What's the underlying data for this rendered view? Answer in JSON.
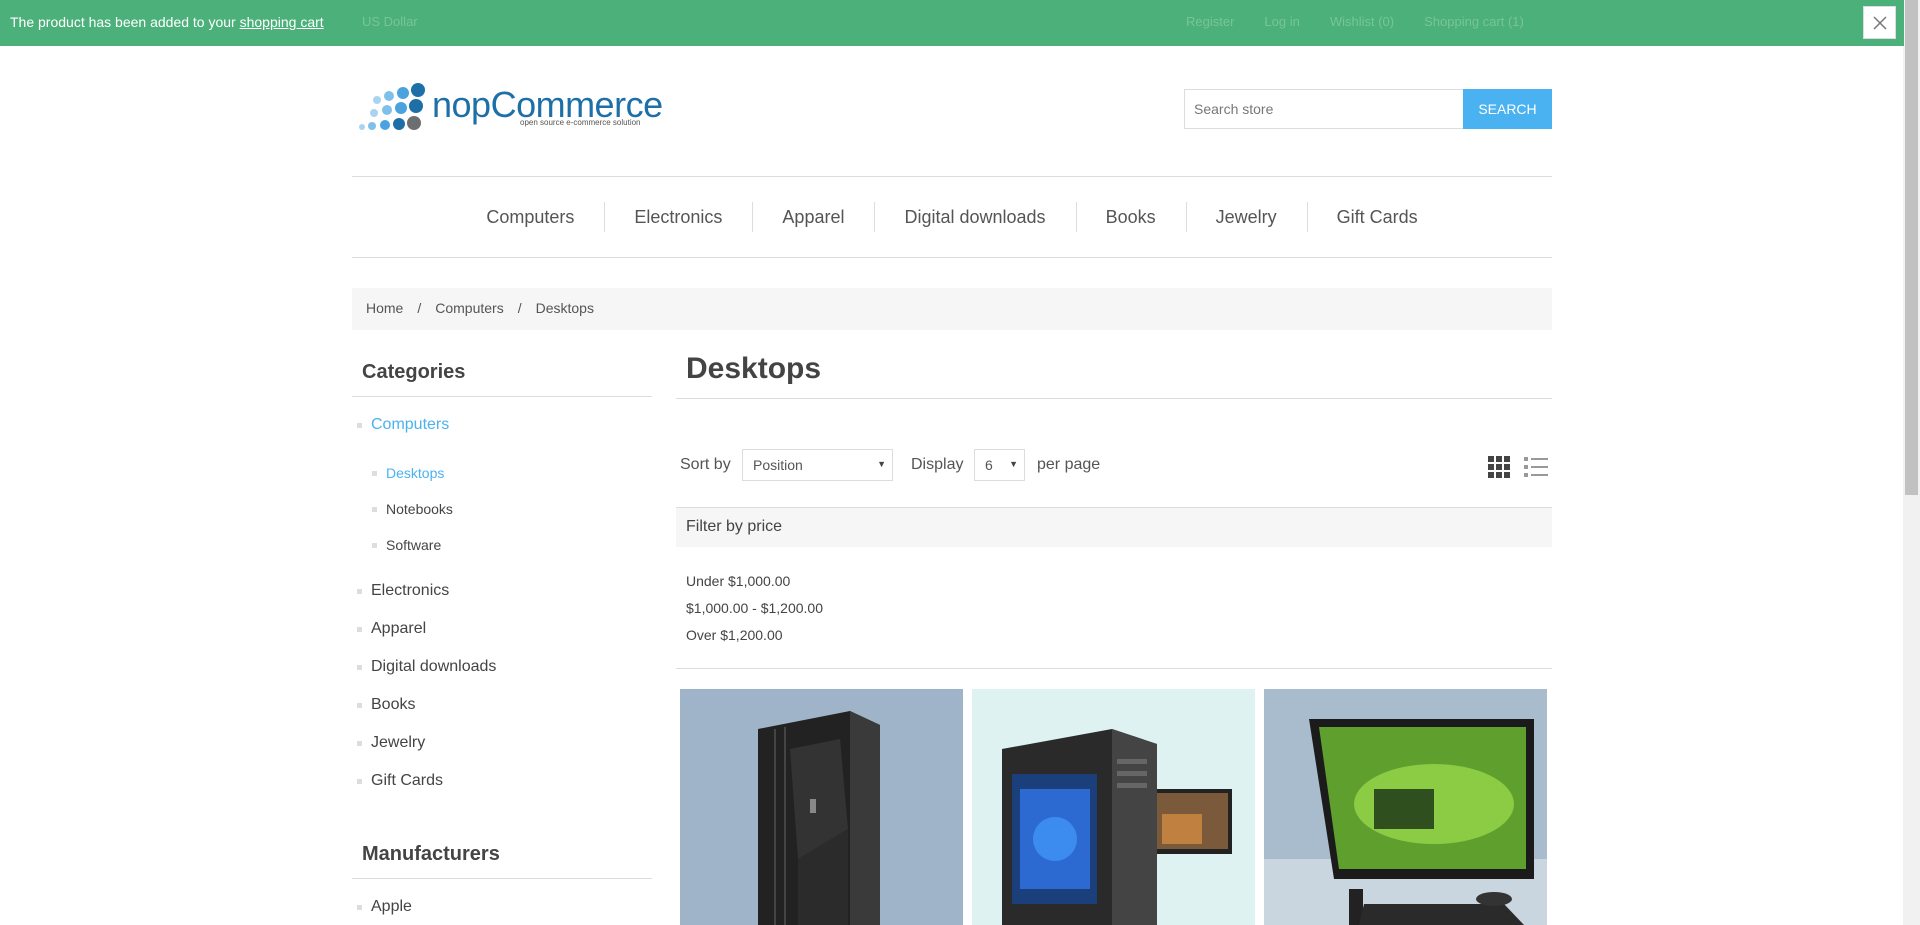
{
  "notification": {
    "text": "The product has been added to your ",
    "link": "shopping cart"
  },
  "header": {
    "currency": "US Dollar",
    "links": [
      "Register",
      "Log in",
      "Wishlist (0)",
      "Shopping cart (1)"
    ],
    "logo_name": "nopCommerce",
    "logo_tagline": "open source e-commerce solution",
    "search_placeholder": "Search store",
    "search_button": "SEARCH"
  },
  "menu": [
    "Computers",
    "Electronics",
    "Apparel",
    "Digital downloads",
    "Books",
    "Jewelry",
    "Gift Cards"
  ],
  "breadcrumb": {
    "home": "Home",
    "sep": "/",
    "level1": "Computers",
    "current": "Desktops"
  },
  "sidebar": {
    "categories_title": "Categories",
    "categories": {
      "computers": "Computers",
      "desktops": "Desktops",
      "notebooks": "Notebooks",
      "software": "Software",
      "electronics": "Electronics",
      "apparel": "Apparel",
      "digital_downloads": "Digital downloads",
      "books": "Books",
      "jewelry": "Jewelry",
      "gift_cards": "Gift Cards"
    },
    "manufacturers_title": "Manufacturers",
    "manufacturer_first": "Apple"
  },
  "main": {
    "title": "Desktops",
    "sort_label": "Sort by",
    "sort_value": "Position",
    "display_label": "Display",
    "display_value": "6",
    "per_page": "per page",
    "filter_title": "Filter by price",
    "price_ranges": [
      "Under $1,000.00",
      "$1,000.00 - $1,200.00",
      "Over $1,200.00"
    ]
  },
  "colors": {
    "accent": "#4ab2f1",
    "notification": "#4bb07a"
  }
}
